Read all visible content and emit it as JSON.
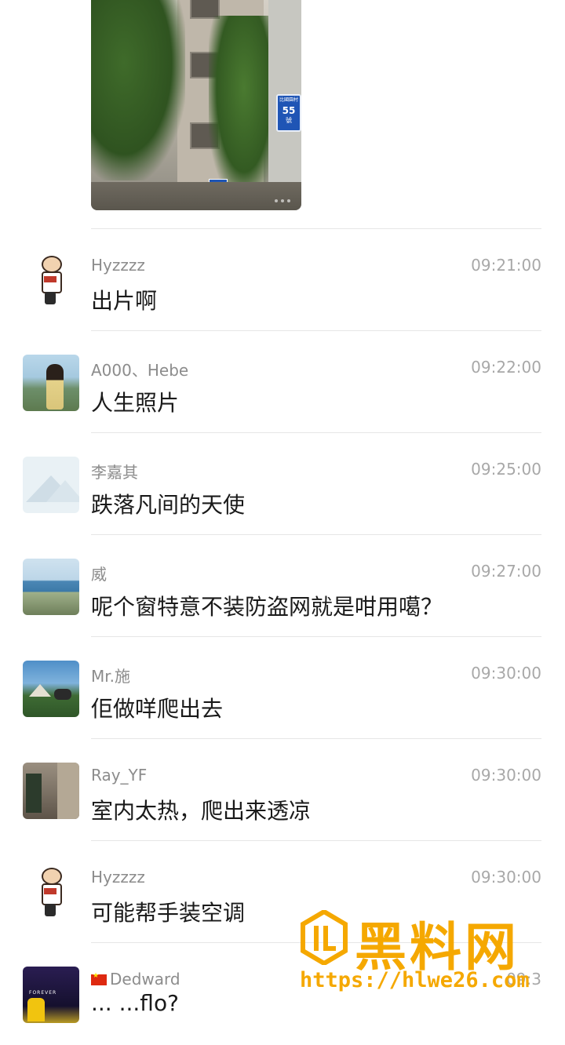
{
  "post_image": {
    "sign_text_top": "比國園村",
    "sign_text_num": "55",
    "sign_text_unit": "號"
  },
  "comments": [
    {
      "name": "Hyzzzz",
      "time": "09:21:00",
      "text": "出片啊",
      "avatar": "cartoon-basketball-avatar"
    },
    {
      "name": "A000、Hebe",
      "time": "09:22:00",
      "text": "人生照片",
      "avatar": "girl-landscape-avatar"
    },
    {
      "name": "李嘉其",
      "time": "09:25:00",
      "text": "跌落凡间的天使",
      "avatar": "placeholder-mountain-avatar"
    },
    {
      "name": "威",
      "time": "09:27:00",
      "text": "呢个窗特意不装防盗网就是咁用噶？",
      "avatar": "beach-avatar"
    },
    {
      "name": "Mr.施",
      "time": "09:30:00",
      "text": "佢做咩爬出去",
      "avatar": "camping-avatar"
    },
    {
      "name": "Ray_YF",
      "time": "09:30:00",
      "text": "室内太热，爬出来透凉",
      "avatar": "street-avatar"
    },
    {
      "name": "Hyzzzz",
      "time": "09:30:00",
      "text": "可能帮手装空调",
      "avatar": "cartoon-basketball-avatar"
    },
    {
      "name": "Dedward",
      "time": "09:3",
      "text": "",
      "avatar": "forever-dark-avatar"
    }
  ],
  "avatar_text": {
    "forever": "FOREVER"
  },
  "partial_text": "... ...flo?",
  "watermark": {
    "title": "黑料网",
    "url": "https://hlwe26.com",
    "color": "#f5a800"
  }
}
